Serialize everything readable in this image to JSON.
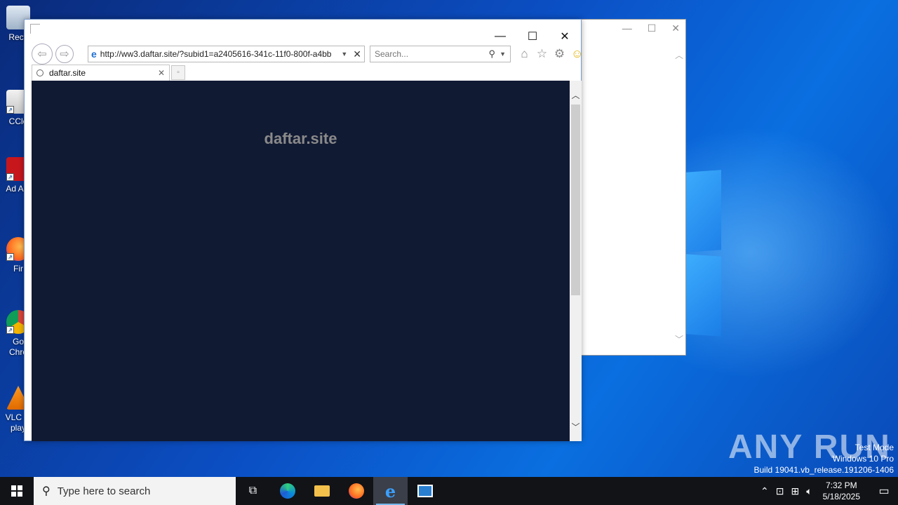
{
  "desktop": {
    "icons": [
      {
        "label": "Recy",
        "icon": "recycle-bin-icon"
      },
      {
        "label": "CCle",
        "icon": "ccleaner-icon"
      },
      {
        "label": "Ad Acr",
        "icon": "adobe-acrobat-icon"
      },
      {
        "label": "Fir",
        "icon": "firefox-icon"
      },
      {
        "label": "Go Chro",
        "icon": "chrome-icon"
      },
      {
        "label": "VLC m play",
        "icon": "vlc-icon"
      }
    ]
  },
  "browser": {
    "address_url": "http://ww3.daftar.site/?subid1=a2405616-341c-11f0-800f-a4bb",
    "search_placeholder": "Search...",
    "tab_label": "daftar.site",
    "page_heading": "daftar.site",
    "controls": {
      "minimize": "—",
      "maximize": "☐",
      "close": "✕"
    }
  },
  "watermark": {
    "brand": "ANY RUN",
    "line1": "Test Mode",
    "line2": "Windows 10 Pro",
    "line3": "Build 19041.vb_release.191206-1406"
  },
  "taskbar": {
    "search_placeholder": "Type here to search",
    "time": "7:32 PM",
    "date": "5/18/2025"
  },
  "colors": {
    "page_background": "#111a33",
    "taskbar": "#111317",
    "accent": "#76b9ed"
  }
}
